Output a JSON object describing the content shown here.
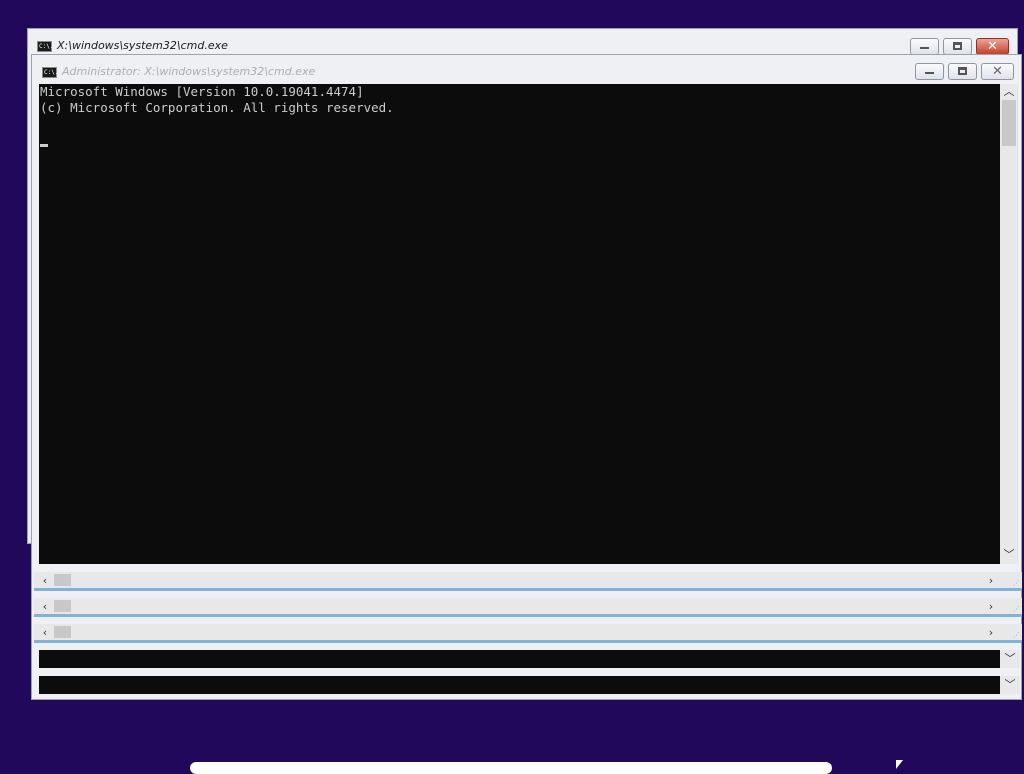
{
  "windows": {
    "back": {
      "title": "X:\\windows\\system32\\cmd.exe",
      "icon_text": "C:\\."
    },
    "front": {
      "title": "Administrator: X:\\windows\\system32\\cmd.exe",
      "icon_text": "C:\\."
    }
  },
  "console": {
    "lines": [
      "Microsoft Windows [Version 10.0.19041.4474]",
      "(c) Microsoft Corporation. All rights reserved."
    ]
  },
  "icons": {
    "minimize": "minimize-icon",
    "maximize": "maximize-icon",
    "close": "close-icon",
    "scroll_left": "‹",
    "scroll_right": "›",
    "scroll_up": "︿",
    "scroll_down": "﹀",
    "strip_down": "﹀"
  },
  "colors": {
    "desktop": "#21085a",
    "console_bg": "#0c0c0c",
    "console_fg": "#cccccc",
    "close_button": "#c2412d",
    "focus_border": "#7fb3dc"
  }
}
